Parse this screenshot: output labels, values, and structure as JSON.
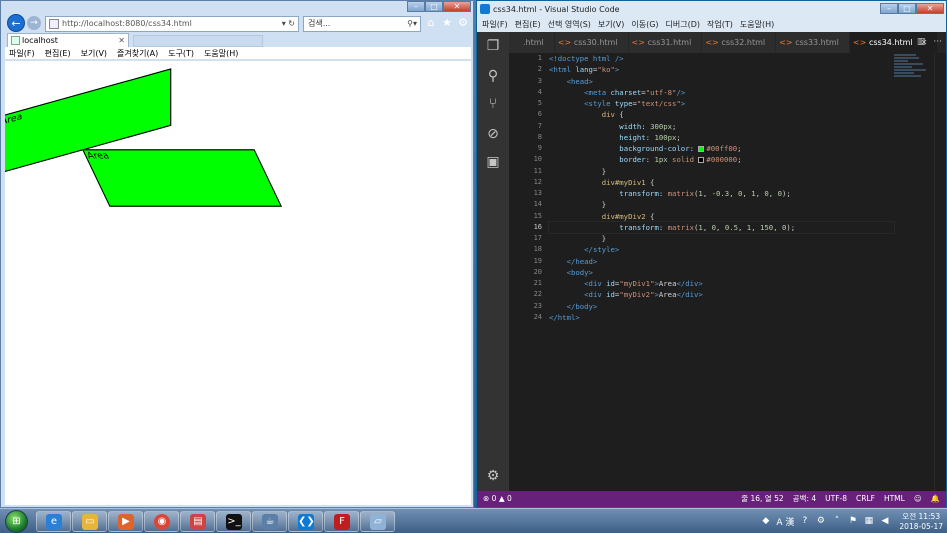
{
  "ie": {
    "address": "http://localhost:8080/css34.html",
    "address_host": "localhost",
    "search_placeholder": "검색...",
    "tab_title": "localhost",
    "menu": [
      "파일(F)",
      "편집(E)",
      "보기(V)",
      "즐겨찾기(A)",
      "도구(T)",
      "도움말(H)"
    ],
    "divs": [
      {
        "id": "myDiv1",
        "text": "Area"
      },
      {
        "id": "myDiv2",
        "text": "Area"
      }
    ]
  },
  "vscode": {
    "title": "css34.html - Visual Studio Code",
    "menu": [
      "파일(F)",
      "편집(E)",
      "선택 영역(S)",
      "보기(V)",
      "이동(G)",
      "디버그(D)",
      "작업(T)",
      "도움말(H)"
    ],
    "tabs": [
      {
        "label": ".html",
        "active": false
      },
      {
        "label": "css30.html",
        "active": false
      },
      {
        "label": "css31.html",
        "active": false
      },
      {
        "label": "css32.html",
        "active": false
      },
      {
        "label": "css33.html",
        "active": false
      },
      {
        "label": "css34.html",
        "active": true
      }
    ],
    "current_line": 16,
    "code_lines": [
      [
        [
          "t-tag",
          "<!doctype html />"
        ]
      ],
      [
        [
          "t-tag",
          "<html "
        ],
        [
          "t-attr",
          "lang"
        ],
        [
          "t-txt",
          "="
        ],
        [
          "t-str",
          "\"ko\""
        ],
        [
          "t-tag",
          ">"
        ]
      ],
      [
        [
          "t-txt",
          "    "
        ],
        [
          "t-tag",
          "<head>"
        ]
      ],
      [
        [
          "t-txt",
          "        "
        ],
        [
          "t-tag",
          "<meta "
        ],
        [
          "t-attr",
          "charset"
        ],
        [
          "t-txt",
          "="
        ],
        [
          "t-str",
          "\"utf-8\""
        ],
        [
          "t-tag",
          "/>"
        ]
      ],
      [
        [
          "t-txt",
          "        "
        ],
        [
          "t-tag",
          "<style "
        ],
        [
          "t-attr",
          "type"
        ],
        [
          "t-txt",
          "="
        ],
        [
          "t-str",
          "\"text/css\""
        ],
        [
          "t-tag",
          ">"
        ]
      ],
      [
        [
          "t-txt",
          "            "
        ],
        [
          "t-sel",
          "div"
        ],
        [
          "t-txt",
          " {"
        ]
      ],
      [
        [
          "t-txt",
          "                "
        ],
        [
          "t-prop",
          "width"
        ],
        [
          "t-txt",
          ": "
        ],
        [
          "t-val",
          "300px"
        ],
        [
          "t-txt",
          ";"
        ]
      ],
      [
        [
          "t-txt",
          "                "
        ],
        [
          "t-prop",
          "height"
        ],
        [
          "t-txt",
          ": "
        ],
        [
          "t-val",
          "100px"
        ],
        [
          "t-txt",
          ";"
        ]
      ],
      [
        [
          "t-txt",
          "                "
        ],
        [
          "t-prop",
          "background-color"
        ],
        [
          "t-txt",
          ": "
        ],
        [
          "swatch",
          "#00ff00"
        ],
        [
          "t-str",
          "#00ff00"
        ],
        [
          "t-txt",
          ";"
        ]
      ],
      [
        [
          "t-txt",
          "                "
        ],
        [
          "t-prop",
          "border"
        ],
        [
          "t-txt",
          ": "
        ],
        [
          "t-val",
          "1px"
        ],
        [
          "t-txt",
          " "
        ],
        [
          "t-str",
          "solid"
        ],
        [
          "t-txt",
          " "
        ],
        [
          "swatch",
          "#000000"
        ],
        [
          "t-str",
          "#000000"
        ],
        [
          "t-txt",
          ";"
        ]
      ],
      [
        [
          "t-txt",
          "            }"
        ]
      ],
      [
        [
          "t-txt",
          "            "
        ],
        [
          "t-sel",
          "div#myDiv1"
        ],
        [
          "t-txt",
          " {"
        ]
      ],
      [
        [
          "t-txt",
          "                "
        ],
        [
          "t-prop",
          "transform"
        ],
        [
          "t-txt",
          ": "
        ],
        [
          "t-str",
          "matrix"
        ],
        [
          "t-txt",
          "("
        ],
        [
          "t-val",
          "1"
        ],
        [
          "t-txt",
          ", "
        ],
        [
          "t-val",
          "-0.3"
        ],
        [
          "t-txt",
          ", "
        ],
        [
          "t-val",
          "0"
        ],
        [
          "t-txt",
          ", "
        ],
        [
          "t-val",
          "1"
        ],
        [
          "t-txt",
          ", "
        ],
        [
          "t-val",
          "0"
        ],
        [
          "t-txt",
          ", "
        ],
        [
          "t-val",
          "0"
        ],
        [
          "t-txt",
          ");"
        ]
      ],
      [
        [
          "t-txt",
          "            }"
        ]
      ],
      [
        [
          "t-txt",
          "            "
        ],
        [
          "t-sel",
          "div#myDiv2"
        ],
        [
          "t-txt",
          " {"
        ]
      ],
      [
        [
          "t-txt",
          "                "
        ],
        [
          "t-prop",
          "transform"
        ],
        [
          "t-txt",
          ": "
        ],
        [
          "t-str",
          "matrix"
        ],
        [
          "t-txt",
          "("
        ],
        [
          "t-val",
          "1"
        ],
        [
          "t-txt",
          ", "
        ],
        [
          "t-val",
          "0"
        ],
        [
          "t-txt",
          ", "
        ],
        [
          "t-val",
          "0.5"
        ],
        [
          "t-txt",
          ", "
        ],
        [
          "t-val",
          "1"
        ],
        [
          "t-txt",
          ", "
        ],
        [
          "t-val",
          "150"
        ],
        [
          "t-txt",
          ", "
        ],
        [
          "t-val",
          "0"
        ],
        [
          "t-txt",
          ");"
        ]
      ],
      [
        [
          "t-txt",
          "            }"
        ]
      ],
      [
        [
          "t-txt",
          "        "
        ],
        [
          "t-tag",
          "</style>"
        ]
      ],
      [
        [
          "t-txt",
          "    "
        ],
        [
          "t-tag",
          "</head>"
        ]
      ],
      [
        [
          "t-txt",
          "    "
        ],
        [
          "t-tag",
          "<body>"
        ]
      ],
      [
        [
          "t-txt",
          "        "
        ],
        [
          "t-tag",
          "<div "
        ],
        [
          "t-attr",
          "id"
        ],
        [
          "t-txt",
          "="
        ],
        [
          "t-str",
          "\"myDiv1\""
        ],
        [
          "t-tag",
          ">"
        ],
        [
          "t-txt",
          "Area"
        ],
        [
          "t-tag",
          "</div>"
        ]
      ],
      [
        [
          "t-txt",
          "        "
        ],
        [
          "t-tag",
          "<div "
        ],
        [
          "t-attr",
          "id"
        ],
        [
          "t-txt",
          "="
        ],
        [
          "t-str",
          "\"myDiv2\""
        ],
        [
          "t-tag",
          ">"
        ],
        [
          "t-txt",
          "Area"
        ],
        [
          "t-tag",
          "</div>"
        ]
      ],
      [
        [
          "t-txt",
          "    "
        ],
        [
          "t-tag",
          "</body>"
        ]
      ],
      [
        [
          "t-tag",
          "</html>"
        ]
      ]
    ],
    "status_left": "⊗ 0 ▲ 0",
    "status_right": [
      "줄 16, 열 52",
      "공백: 4",
      "UTF-8",
      "CRLF",
      "HTML",
      "☺",
      "🔔"
    ]
  },
  "taskbar": {
    "ime_mode": "A 漢",
    "time": "오전 11:53",
    "date": "2018-05-17"
  }
}
